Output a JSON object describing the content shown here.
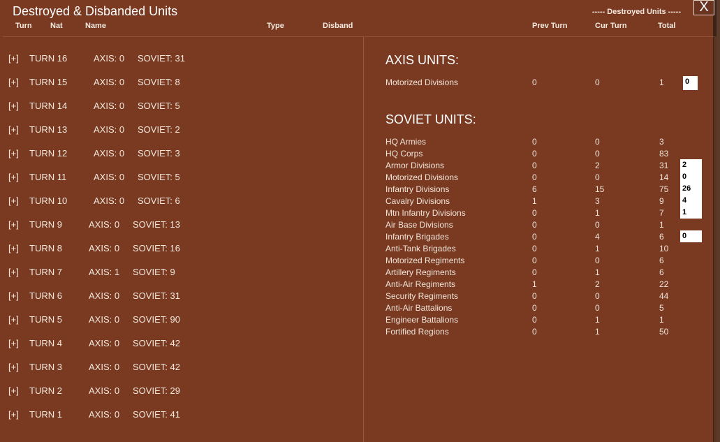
{
  "window": {
    "title": "Destroyed & Disbanded Units",
    "section_label": "----- Destroyed Units -----",
    "close_label": "X"
  },
  "columns": {
    "turn": "Turn",
    "nat": "Nat",
    "name": "Name",
    "type": "Type",
    "disband": "Disband",
    "prev_turn": "Prev Turn",
    "cur_turn": "Cur Turn",
    "total": "Total"
  },
  "turns": [
    {
      "expand": "[+]",
      "turn": "TURN 16",
      "axis": "AXIS: 0",
      "soviet": "SOVIET: 31"
    },
    {
      "expand": "[+]",
      "turn": "TURN 15",
      "axis": "AXIS: 0",
      "soviet": "SOVIET: 8"
    },
    {
      "expand": "[+]",
      "turn": "TURN 14",
      "axis": "AXIS: 0",
      "soviet": "SOVIET: 5"
    },
    {
      "expand": "[+]",
      "turn": "TURN 13",
      "axis": "AXIS: 0",
      "soviet": "SOVIET: 2"
    },
    {
      "expand": "[+]",
      "turn": "TURN 12",
      "axis": "AXIS: 0",
      "soviet": "SOVIET: 3"
    },
    {
      "expand": "[+]",
      "turn": "TURN 11",
      "axis": "AXIS: 0",
      "soviet": "SOVIET: 5"
    },
    {
      "expand": "[+]",
      "turn": "TURN 10",
      "axis": "AXIS: 0",
      "soviet": "SOVIET: 6"
    },
    {
      "expand": "[+]",
      "turn": "TURN 9",
      "axis": "AXIS: 0",
      "soviet": "SOVIET: 13"
    },
    {
      "expand": "[+]",
      "turn": "TURN 8",
      "axis": "AXIS: 0",
      "soviet": "SOVIET: 16"
    },
    {
      "expand": "[+]",
      "turn": "TURN 7",
      "axis": "AXIS: 1",
      "soviet": "SOVIET: 9"
    },
    {
      "expand": "[+]",
      "turn": "TURN 6",
      "axis": "AXIS: 0",
      "soviet": "SOVIET: 31"
    },
    {
      "expand": "[+]",
      "turn": "TURN 5",
      "axis": "AXIS: 0",
      "soviet": "SOVIET: 90"
    },
    {
      "expand": "[+]",
      "turn": "TURN 4",
      "axis": "AXIS: 0",
      "soviet": "SOVIET: 42"
    },
    {
      "expand": "[+]",
      "turn": "TURN 3",
      "axis": "AXIS: 0",
      "soviet": "SOVIET: 42"
    },
    {
      "expand": "[+]",
      "turn": "TURN 2",
      "axis": "AXIS: 0",
      "soviet": "SOVIET: 29"
    },
    {
      "expand": "[+]",
      "turn": "TURN 1",
      "axis": "AXIS: 0",
      "soviet": "SOVIET: 41"
    }
  ],
  "axis": {
    "heading": "AXIS UNITS:",
    "units": [
      {
        "name": "Motorized Divisions",
        "prev": "0",
        "cur": "0",
        "total": "1",
        "disband": "0"
      }
    ]
  },
  "soviet": {
    "heading": "SOVIET UNITS:",
    "units": [
      {
        "name": "HQ Armies",
        "prev": "0",
        "cur": "0",
        "total": "3"
      },
      {
        "name": "HQ Corps",
        "prev": "0",
        "cur": "0",
        "total": "83"
      },
      {
        "name": "Armor Divisions",
        "prev": "0",
        "cur": "2",
        "total": "31",
        "disband": "2"
      },
      {
        "name": "Motorized Divisions",
        "prev": "0",
        "cur": "0",
        "total": "14",
        "disband": "0"
      },
      {
        "name": "Infantry Divisions",
        "prev": "6",
        "cur": "15",
        "total": "75",
        "disband": "26"
      },
      {
        "name": "Cavalry Divisions",
        "prev": "1",
        "cur": "3",
        "total": "9",
        "disband": "4"
      },
      {
        "name": "Mtn Infantry Divisions",
        "prev": "0",
        "cur": "1",
        "total": "7",
        "disband": "1"
      },
      {
        "name": "Air Base Divisions",
        "prev": "0",
        "cur": "0",
        "total": "1"
      },
      {
        "name": "Infantry Brigades",
        "prev": "0",
        "cur": "4",
        "total": "6",
        "disband": "0"
      },
      {
        "name": "Anti-Tank Brigades",
        "prev": "0",
        "cur": "1",
        "total": "10"
      },
      {
        "name": "Motorized Regiments",
        "prev": "0",
        "cur": "0",
        "total": "6"
      },
      {
        "name": "Artillery Regiments",
        "prev": "0",
        "cur": "1",
        "total": "6"
      },
      {
        "name": "Anti-Air Regiments",
        "prev": "1",
        "cur": "2",
        "total": "22"
      },
      {
        "name": "Security Regiments",
        "prev": "0",
        "cur": "0",
        "total": "44"
      },
      {
        "name": "Anti-Air Battalions",
        "prev": "0",
        "cur": "0",
        "total": "5"
      },
      {
        "name": "Engineer Battalions",
        "prev": "0",
        "cur": "1",
        "total": "1"
      },
      {
        "name": "Fortified Regions",
        "prev": "0",
        "cur": "1",
        "total": "50"
      }
    ]
  }
}
